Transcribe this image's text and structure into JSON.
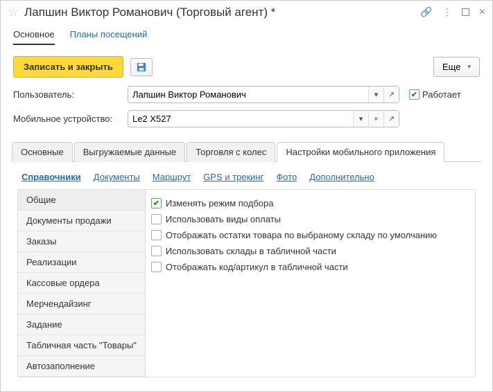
{
  "title": "Лапшин Виктор Романович (Торговый агент) *",
  "navs": {
    "main": "Основное",
    "plans": "Планы посещений"
  },
  "toolbar": {
    "save_close": "Записать и закрыть",
    "more": "Еще"
  },
  "fields": {
    "user_label": "Пользователь:",
    "user_value": "Лапшин Виктор Романович",
    "device_label": "Мобильное устройство:",
    "device_value": "Le2 X527",
    "works_label": "Работает"
  },
  "tabs": {
    "t1": "Основные",
    "t2": "Выгружаемые данные",
    "t3": "Торговля с колес",
    "t4": "Настройки мобильного приложения"
  },
  "subnav": {
    "s1": "Справочники",
    "s2": "Документы",
    "s3": "Маршрут",
    "s4": "GPS и трекинг",
    "s5": "Фото",
    "s6": "Дополнительно"
  },
  "sidelist": {
    "i1": "Общие",
    "i2": "Документы продажи",
    "i3": "Заказы",
    "i4": "Реализации",
    "i5": "Кассовые ордера",
    "i6": "Мерчендайзинг",
    "i7": "Задание",
    "i8": "Табличная часть \"Товары\"",
    "i9": "Автозаполнение"
  },
  "options": {
    "o1": "Изменять режим подбора",
    "o2": "Использовать виды оплаты",
    "o3": "Отображать остатки товара по выбраному складу по умолчанию",
    "o4": "Использовать склады в табличной части",
    "o5": "Отображать код/артикул в табличной части"
  }
}
